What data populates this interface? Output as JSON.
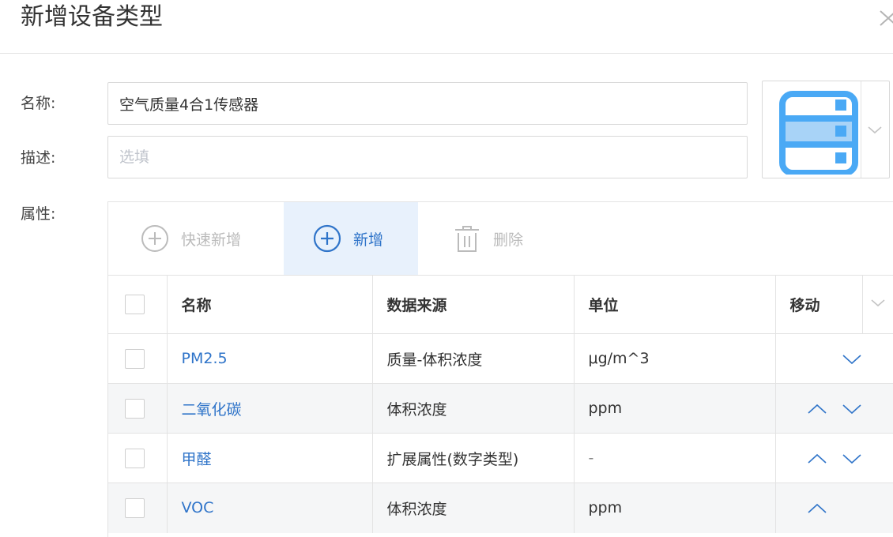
{
  "dialog": {
    "title": "新增设备类型"
  },
  "form": {
    "name_label": "名称:",
    "name_value": "空气质量4合1传感器",
    "desc_label": "描述:",
    "desc_placeholder": "选填",
    "attr_label": "属性:"
  },
  "icon_picker": {
    "selected_icon": "server-rack-icon",
    "accent_color": "#4aa9f5",
    "highlight_color": "#a8d3f7"
  },
  "toolbar": {
    "quick_add_label": "快速新增",
    "add_label": "新增",
    "delete_label": "删除"
  },
  "table": {
    "columns": {
      "name": "名称",
      "source": "数据来源",
      "unit": "单位",
      "move": "移动"
    },
    "rows": [
      {
        "name": "PM2.5",
        "source": "质量-体积浓度",
        "unit": "μg/m^3",
        "can_move_up": false,
        "can_move_down": true
      },
      {
        "name": "二氧化碳",
        "source": "体积浓度",
        "unit": "ppm",
        "can_move_up": true,
        "can_move_down": true
      },
      {
        "name": "甲醛",
        "source": "扩展属性(数字类型)",
        "unit": "-",
        "can_move_up": true,
        "can_move_down": true
      },
      {
        "name": "VOC",
        "source": "体积浓度",
        "unit": "ppm",
        "can_move_up": true,
        "can_move_down": false
      }
    ]
  },
  "colors": {
    "primary": "#2f74c9",
    "primary_bg": "#e8f1fc",
    "disabled": "#bbbbbb",
    "row_alt": "#f5f6f7",
    "border": "#e3e3e3"
  }
}
